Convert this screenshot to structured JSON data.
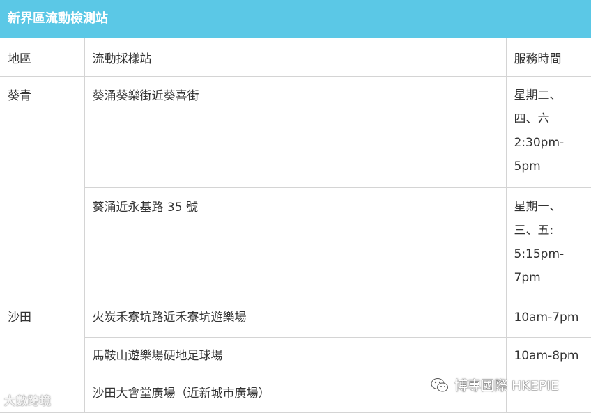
{
  "title": "新界區流動檢測站",
  "headers": {
    "district": "地區",
    "station": "流動採樣站",
    "hours": "服務時間"
  },
  "rows": [
    {
      "district": "葵青",
      "station": "葵涌葵樂街近葵喜街",
      "hours": [
        "星期二、",
        "四、六",
        "2:30pm-",
        "5pm"
      ]
    },
    {
      "station": "葵涌近永基路 35 號",
      "hours": [
        "星期一、",
        "三、五:",
        "5:15pm-",
        "7pm"
      ]
    },
    {
      "district": "沙田",
      "station": "火炭禾寮坑路近禾寮坑遊樂場",
      "hours": [
        "10am-7pm"
      ]
    },
    {
      "station": "馬鞍山遊樂場硬地足球場",
      "hours": [
        "10am-8pm"
      ]
    },
    {
      "station": "沙田大會堂廣場（近新城市廣場）"
    }
  ],
  "watermarks": {
    "left": "大數跨境",
    "right": "博專國際 HKEPIE"
  },
  "colors": {
    "title_bg": "#5bc8e6",
    "border": "#d4d4d4",
    "text": "#333333"
  },
  "icons": {
    "right_watermark": "wechat-icon"
  }
}
